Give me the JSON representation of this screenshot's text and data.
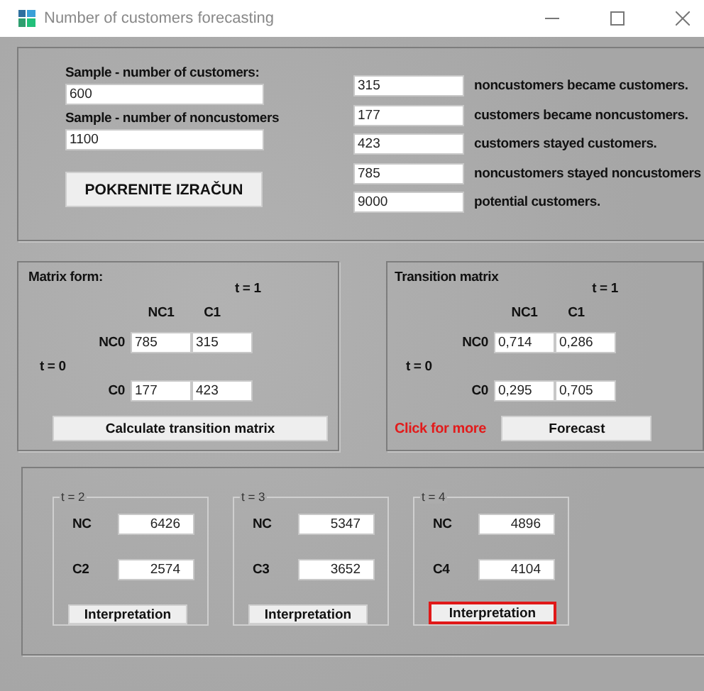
{
  "window": {
    "title": "Number of customers forecasting"
  },
  "sample": {
    "customers_label": "Sample - number of customers:",
    "customers": "600",
    "noncustomers_label": "Sample - number of noncustomers",
    "noncustomers": "1100",
    "button": "POKRENITE IZRAČUN"
  },
  "results": [
    {
      "value": "315",
      "label": "noncustomers became customers."
    },
    {
      "value": "177",
      "label": "customers became noncustomers."
    },
    {
      "value": "423",
      "label": "customers stayed customers."
    },
    {
      "value": "785",
      "label": "noncustomers stayed noncustomers"
    },
    {
      "value": "9000",
      "label": "potential customers."
    }
  ],
  "matrix_form": {
    "title": "Matrix form:",
    "t1": "t = 1",
    "t0": "t = 0",
    "columns": [
      "NC1",
      "C1"
    ],
    "rows": [
      {
        "label": "NC0",
        "values": [
          "785",
          "315"
        ]
      },
      {
        "label": "C0",
        "values": [
          "177",
          "423"
        ]
      }
    ],
    "button": "Calculate transition matrix"
  },
  "transition_matrix": {
    "title": "Transition matrix",
    "t1": "t = 1",
    "t0": "t = 0",
    "columns": [
      "NC1",
      "C1"
    ],
    "rows": [
      {
        "label": "NC0",
        "values": [
          "0,714",
          "0,286"
        ]
      },
      {
        "label": "C0",
        "values": [
          "0,295",
          "0,705"
        ]
      }
    ],
    "link": "Click for more",
    "button": "Forecast"
  },
  "forecasts": [
    {
      "legend": "t = 2",
      "nc_label": "NC",
      "nc": "6426",
      "c_label": "C2",
      "c": "2574",
      "button": "Interpretation",
      "highlighted": false
    },
    {
      "legend": "t = 3",
      "nc_label": "NC",
      "nc": "5347",
      "c_label": "C3",
      "c": "3652",
      "button": "Interpretation",
      "highlighted": false
    },
    {
      "legend": "t = 4",
      "nc_label": "NC",
      "nc": "4896",
      "c_label": "C4",
      "c": "4104",
      "button": "Interpretation",
      "highlighted": true
    }
  ]
}
